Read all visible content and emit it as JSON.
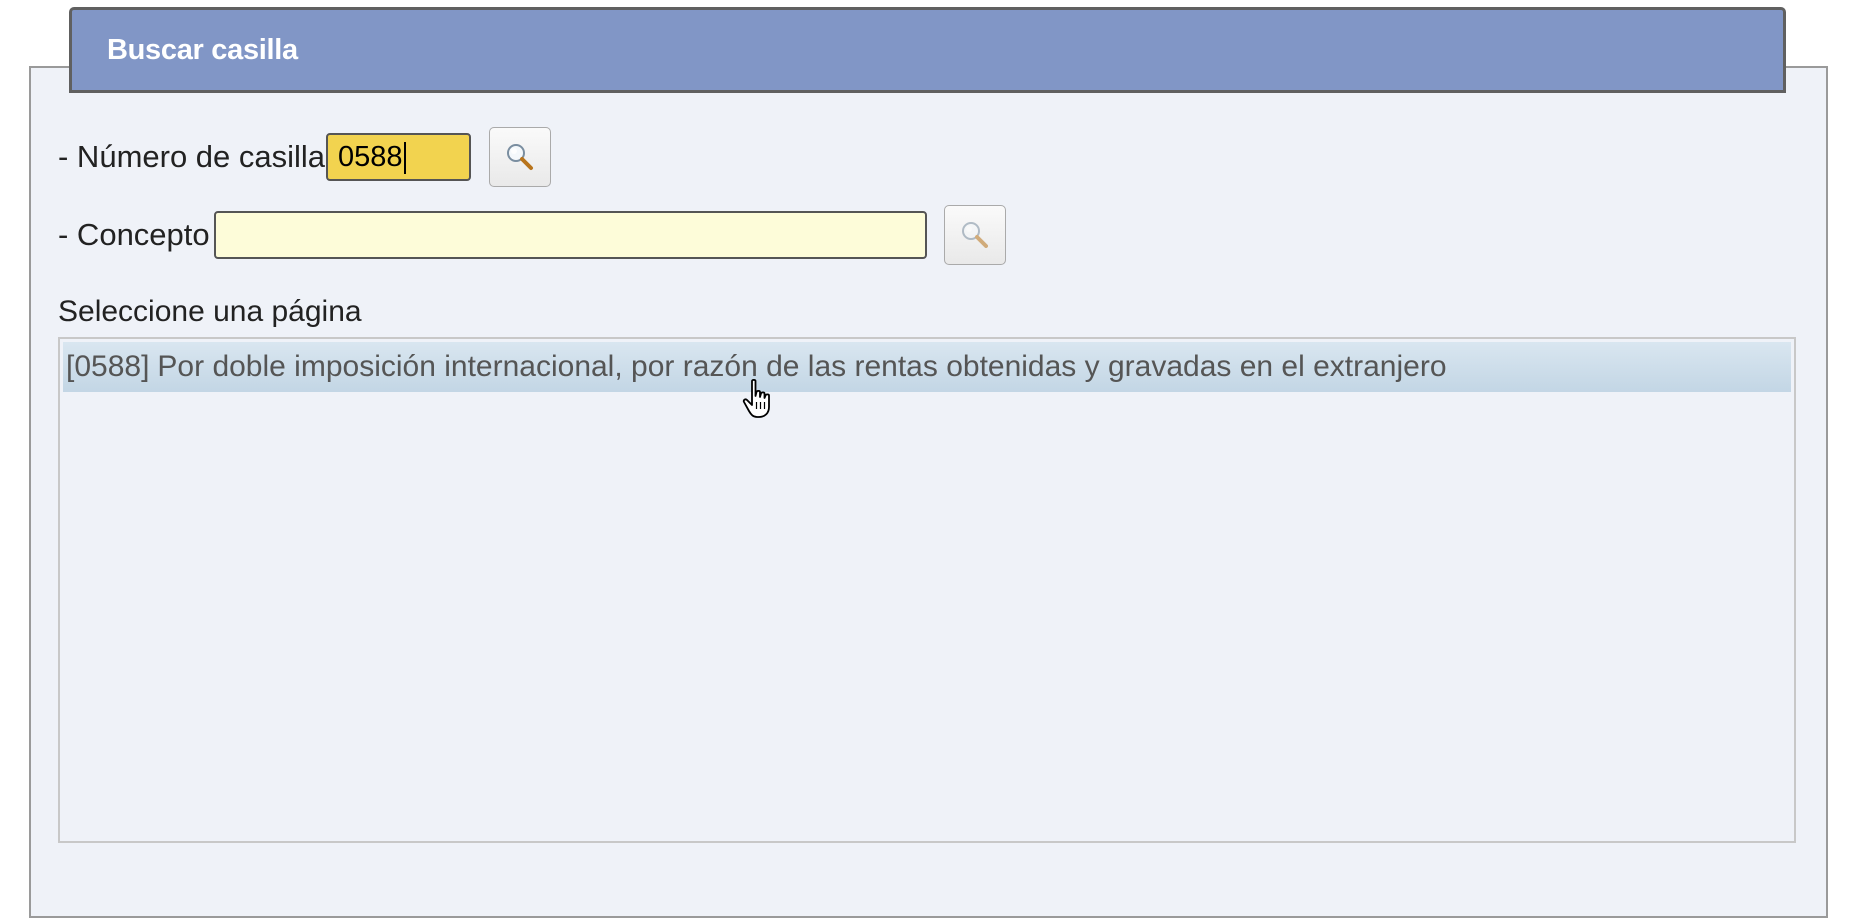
{
  "header": {
    "title": "Buscar casilla"
  },
  "numero_casilla": {
    "label": "- Número de casilla",
    "value": "0588"
  },
  "concepto": {
    "label": "- Concepto",
    "value": ""
  },
  "pagina_list": {
    "label": "Seleccione una página",
    "items": [
      {
        "code": "[0588]",
        "text": "Por doble imposición internacional, por razón de las rentas obtenidas y gravadas en el extranjero"
      }
    ]
  },
  "icons": {
    "search": "magnifier-icon",
    "pointer": "hand-pointer-icon"
  },
  "colors": {
    "header_bg": "#8196c6",
    "numero_input_bg": "#f2d34f",
    "concepto_input_bg": "#fdfcd9",
    "selected_row": "#c3d6e5"
  }
}
